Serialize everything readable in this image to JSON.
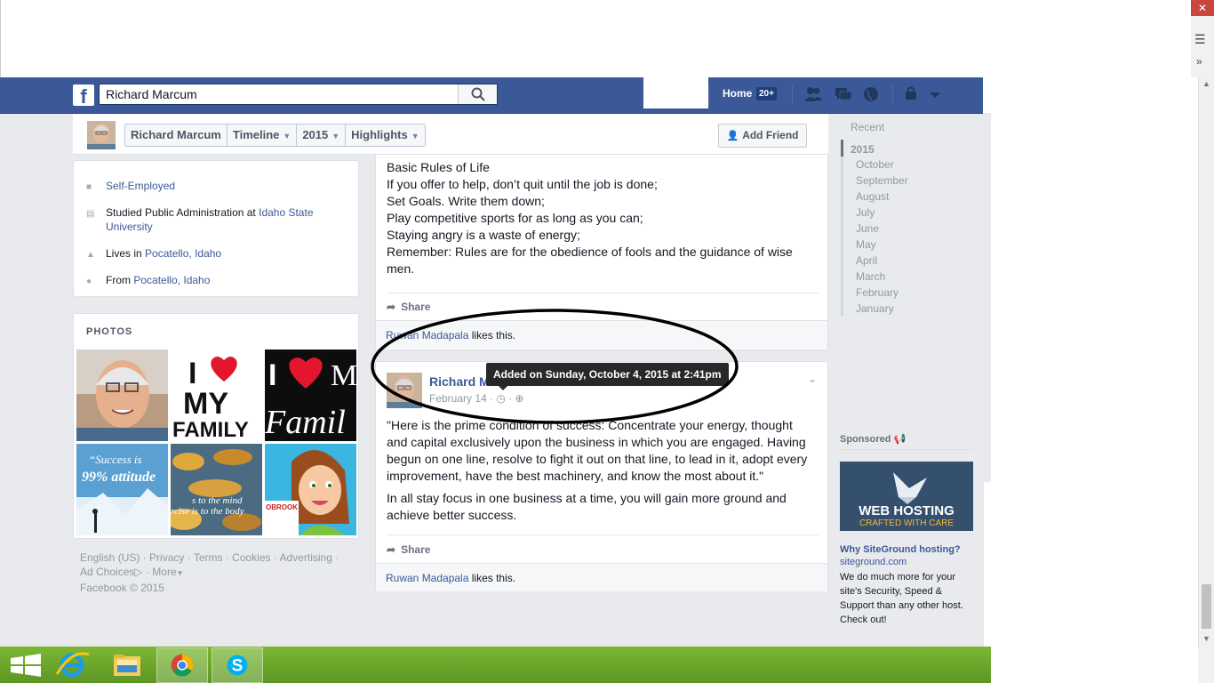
{
  "search": {
    "value": "Richard Marcum"
  },
  "header": {
    "home_label": "Home",
    "home_badge": "20+"
  },
  "timeline_nav": {
    "crumbs": [
      {
        "label": "Richard Marcum",
        "dropdown": false
      },
      {
        "label": "Timeline",
        "dropdown": true
      },
      {
        "label": "2015",
        "dropdown": true
      },
      {
        "label": "Highlights",
        "dropdown": true
      }
    ],
    "add_friend": "Add Friend"
  },
  "about": {
    "work": "Self-Employed",
    "studied_prefix": "Studied Public Administration at",
    "studied_school": "Idaho State University",
    "lives_prefix": "Lives in",
    "lives_place": "Pocatello, Idaho",
    "from_prefix": "From",
    "from_place": "Pocatello, Idaho"
  },
  "photos": {
    "title": "PHOTOS",
    "items": [
      {
        "name": "profile-photo",
        "text": ""
      },
      {
        "name": "i-love-my-family-photo",
        "text_top": "I",
        "text_mid": "MY",
        "text_bot": "FAMILY"
      },
      {
        "name": "i-love-my-family-dark-photo",
        "text_top": "I",
        "text_bot": "Famil"
      },
      {
        "name": "success-attitude-photo",
        "text_top": "“Success is",
        "text_mid": "99% attitude"
      },
      {
        "name": "autumn-leaves-photo",
        "text_mid": "s to the mind",
        "text_bot": "rcise is to the body"
      },
      {
        "name": "cartoon-woman-photo",
        "text_mid": "OBROOK"
      }
    ]
  },
  "footer": {
    "links": [
      "English (US)",
      "Privacy",
      "Terms",
      "Cookies",
      "Advertising",
      "Ad Choices",
      "More"
    ],
    "copyright": "Facebook © 2015"
  },
  "post1": {
    "lines": [
      "Basic Rules of Life",
      "If you offer to help, don’t quit until the job is done;",
      "Set Goals. Write them down;",
      "Play competitive sports for as long as you can;",
      "Staying angry is a waste of energy;",
      "Remember: Rules are for the obedience of fools and the guidance of wise men."
    ],
    "share": "Share",
    "liker": "Ruwan Madapala",
    "likes_suffix": "likes this."
  },
  "post2": {
    "author": "Richard M",
    "date": "February 14",
    "paragraph1": "\"Here is the prime condition of success: Concentrate your energy, thought and capital exclusively upon the business in which you are engaged. Having begun on one line, resolve to fight it out on that line, to lead in it, adopt every improvement, have the best machinery, and know the most about it.\"",
    "paragraph2": "In all stay focus in one business at a time, you will gain more ground and achieve better success.",
    "share": "Share",
    "liker": "Ruwan Madapala",
    "likes_suffix": "likes this.",
    "tooltip": "Added on Sunday, October 4, 2015 at 2:41pm"
  },
  "year_nav": {
    "recent": "Recent",
    "year": "2015",
    "months": [
      "October",
      "September",
      "August",
      "July",
      "June",
      "May",
      "April",
      "March",
      "February",
      "January"
    ]
  },
  "ad": {
    "sponsored": "Sponsored",
    "img_line1": "WEB HOSTING",
    "img_line2": "CRAFTED WITH CARE",
    "title": "Why SiteGround hosting?",
    "domain": "siteground.com",
    "body": "We do much more for your site's Security, Speed & Support than any other host. Check out!"
  },
  "colors": {
    "fb_blue": "#3b5998",
    "taskbar_green": "#6ba32a",
    "tooltip_bg": "#282828"
  }
}
